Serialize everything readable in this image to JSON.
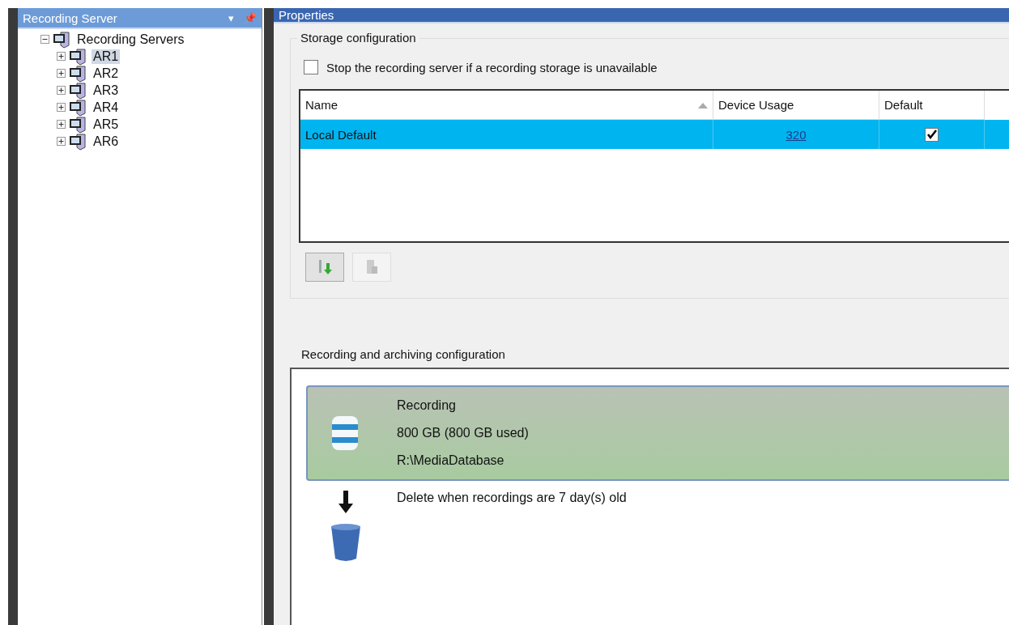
{
  "left_panel": {
    "title": "Recording Server",
    "dropdown_glyph": "▾",
    "pin_glyph": "📌",
    "tree": {
      "label": "Recording Servers",
      "expanded": true,
      "selected": false,
      "children": [
        {
          "label": "AR1",
          "expanded": false,
          "selected": true
        },
        {
          "label": "AR2",
          "expanded": false,
          "selected": false
        },
        {
          "label": "AR3",
          "expanded": false,
          "selected": false
        },
        {
          "label": "AR4",
          "expanded": false,
          "selected": false
        },
        {
          "label": "AR5",
          "expanded": false,
          "selected": false
        },
        {
          "label": "AR6",
          "expanded": false,
          "selected": false
        }
      ]
    }
  },
  "properties": {
    "title": "Properties",
    "storage": {
      "title": "Storage configuration",
      "stop_option": {
        "label": "Stop the recording server if a recording storage is unavailable",
        "checked": false
      },
      "table": {
        "columns": [
          "Name",
          "Device Usage",
          "Default"
        ],
        "rows": [
          {
            "name": "Local Default",
            "device_usage": "320",
            "default": true,
            "selected": true
          }
        ]
      },
      "buttons": [
        {
          "kind": "add",
          "disabled": false
        },
        {
          "kind": "remove",
          "disabled": true
        }
      ]
    },
    "archiving": {
      "title": "Recording and archiving configuration",
      "recording": {
        "title": "Recording",
        "size": "800 GB (800 GB used)",
        "path": "R:\\MediaDatabase"
      },
      "delete_rule": "Delete when recordings are 7 day(s) old"
    }
  }
}
